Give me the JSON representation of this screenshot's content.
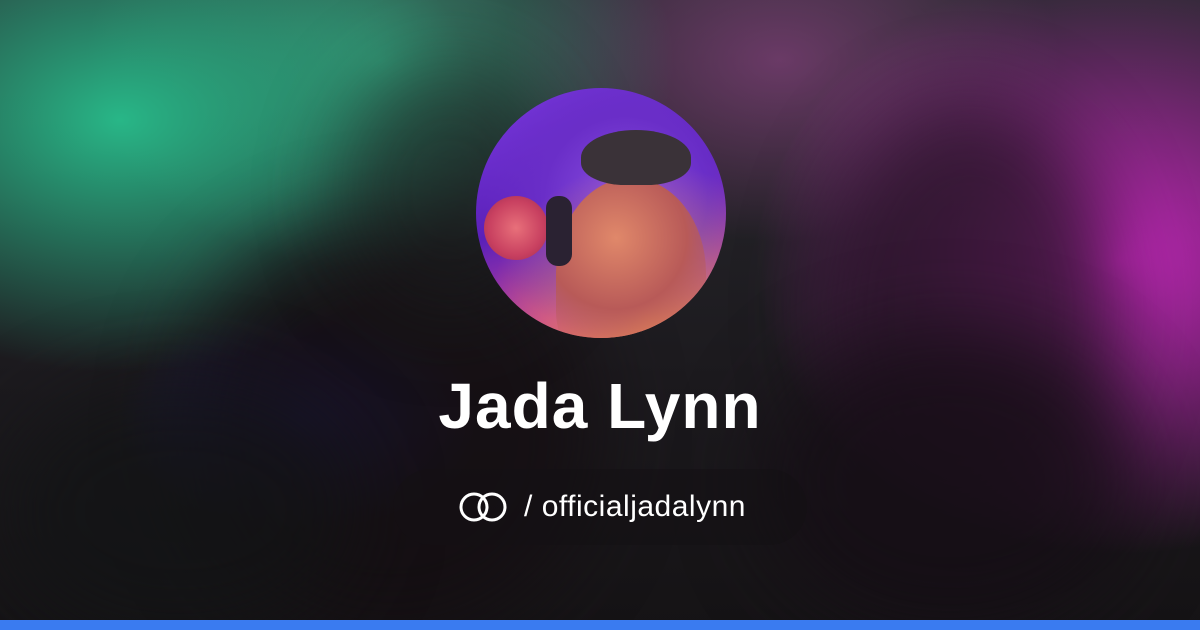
{
  "profile": {
    "name": "Jada Lynn",
    "handle": "/ officialjadalynn",
    "brand_icon": "linktree-rings-icon",
    "avatar_alt": "profile-photo"
  },
  "colors": {
    "text": "#ffffff",
    "accent_bar": "#3a7bf0",
    "pill_bg": "rgba(20,16,20,0.55)",
    "bg_green": "#28be8c",
    "bg_magenta": "#d228c8"
  }
}
